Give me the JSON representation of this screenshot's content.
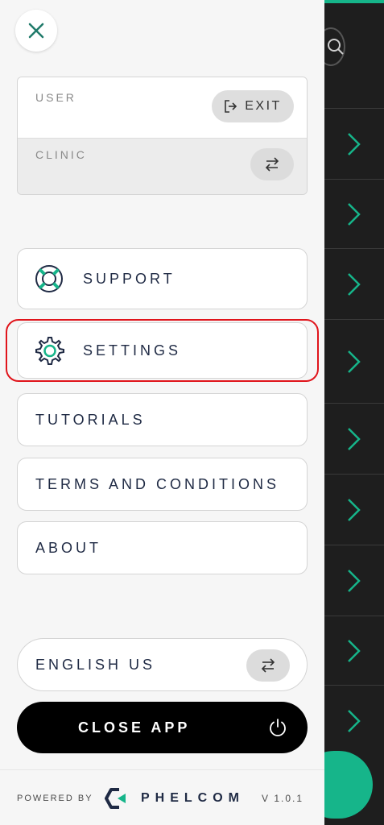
{
  "drawer": {
    "user_label": "USER",
    "exit_label": "EXIT",
    "clinic_label": "CLINIC",
    "menu": {
      "support": "SUPPORT",
      "settings": "SETTINGS",
      "tutorials": "TUTORIALS",
      "terms": "TERMS AND CONDITIONS",
      "about": "ABOUT"
    },
    "language": "ENGLISH US",
    "close_app": "CLOSE APP",
    "powered_by": "POWERED BY",
    "brand": "PHELCOM",
    "version": "V 1.0.1"
  },
  "colors": {
    "accent": "#16b58a",
    "text": "#1f2a44",
    "highlight": "#e0141b"
  },
  "icons": [
    "close-icon",
    "exit-icon",
    "swap-icon",
    "lifebuoy-icon",
    "gear-icon",
    "power-icon",
    "search-icon",
    "chevron-right-icon"
  ]
}
